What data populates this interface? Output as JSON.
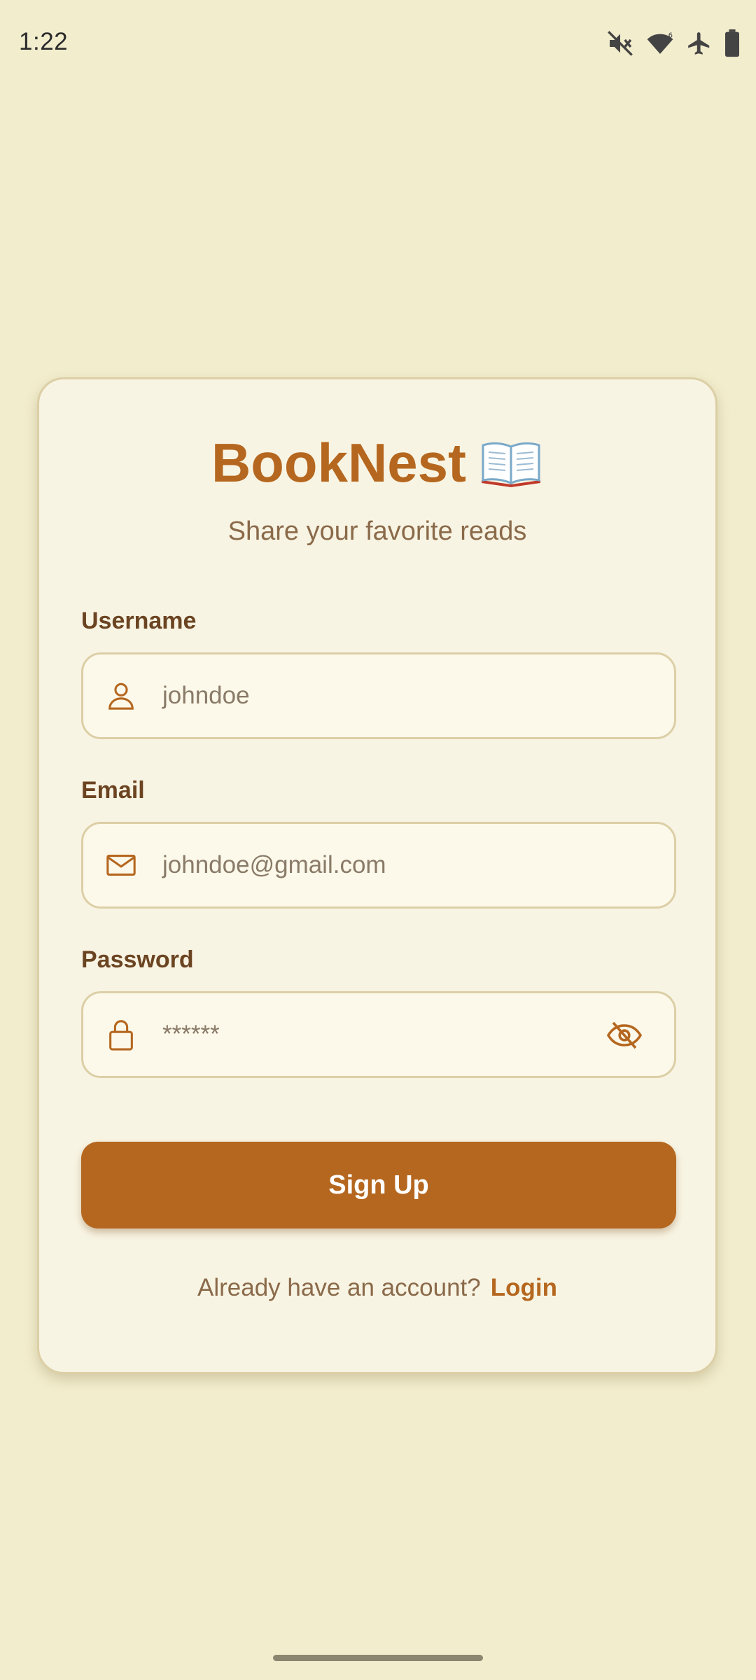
{
  "status_bar": {
    "time": "1:22",
    "icons": [
      "mute-icon",
      "wifi-icon",
      "airplane-icon",
      "battery-icon"
    ]
  },
  "app": {
    "title": "BookNest",
    "title_icon": "open-book-icon",
    "subtitle": "Share your favorite reads"
  },
  "form": {
    "username": {
      "label": "Username",
      "placeholder": "johndoe",
      "icon": "person-icon"
    },
    "email": {
      "label": "Email",
      "placeholder": "johndoe@gmail.com",
      "icon": "mail-icon"
    },
    "password": {
      "label": "Password",
      "placeholder": "******",
      "icon": "lock-icon",
      "toggle_icon": "eye-off-icon"
    },
    "submit_label": "Sign Up"
  },
  "footer": {
    "prompt": "Already have an account?",
    "link": "Login"
  },
  "colors": {
    "background": "#f2edcd",
    "card": "#f8f4e3",
    "accent": "#b5671f",
    "label": "#6b4422",
    "muted": "#8a6a4a"
  }
}
